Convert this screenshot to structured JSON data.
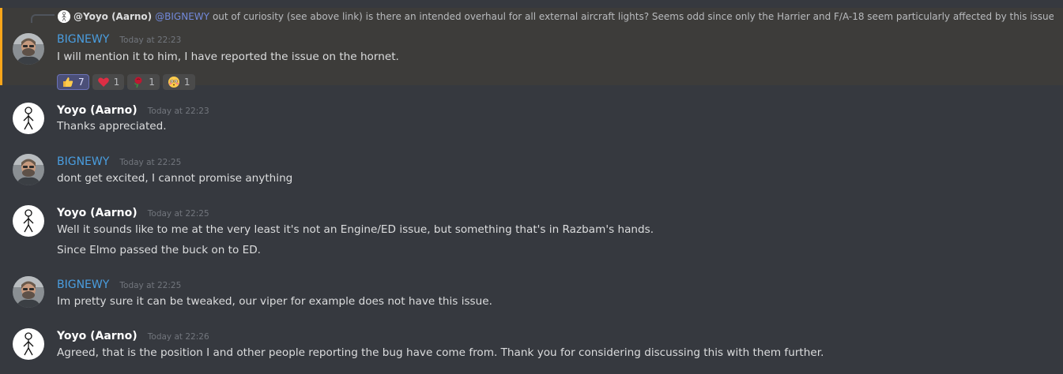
{
  "reply": {
    "user": "@Yoyo (Aarno)",
    "mention": "@BIGNEWY",
    "text": "out of curiosity (see above link) is there an intended overhaul for all external aircraft lights? Seems odd since only the Harrier and F/A-18 seem particularly affected by this issue ..."
  },
  "messages": [
    {
      "user": "BIGNEWY",
      "timestamp": "Today at 22:23",
      "lines": [
        "I will mention it to him, I have reported the issue on the hornet."
      ],
      "reactions": [
        {
          "emoji": "thumbs-up",
          "count": "7"
        },
        {
          "emoji": "red-heart",
          "count": "1"
        },
        {
          "emoji": "rose",
          "count": "1"
        },
        {
          "emoji": "flushed-face",
          "count": "1"
        }
      ]
    },
    {
      "user": "Yoyo (Aarno)",
      "timestamp": "Today at 22:23",
      "lines": [
        "Thanks appreciated."
      ]
    },
    {
      "user": "BIGNEWY",
      "timestamp": "Today at 22:25",
      "lines": [
        "dont get excited, I cannot promise anything"
      ]
    },
    {
      "user": "Yoyo (Aarno)",
      "timestamp": "Today at 22:25",
      "lines": [
        "Well it sounds like to me at the very least it's not an Engine/ED issue, but something that's in Razbam's hands.",
        "Since Elmo passed the buck on to ED."
      ]
    },
    {
      "user": "BIGNEWY",
      "timestamp": "Today at 22:25",
      "lines": [
        "Im pretty sure it can be tweaked, our viper for example does not have this issue."
      ]
    },
    {
      "user": "Yoyo (Aarno)",
      "timestamp": "Today at 22:26",
      "lines": [
        "Agreed, that is the position I and other people reporting the bug have come from. Thank you for considering discussing this with them further."
      ]
    }
  ],
  "colors": {
    "background": "#36393f",
    "highlight_background": "#3d3c3a",
    "highlight_border": "#faa61a",
    "staff_name": "#4a9ee0",
    "member_name": "#ffffff",
    "timestamp": "#72767d",
    "mention": "#7289da"
  }
}
